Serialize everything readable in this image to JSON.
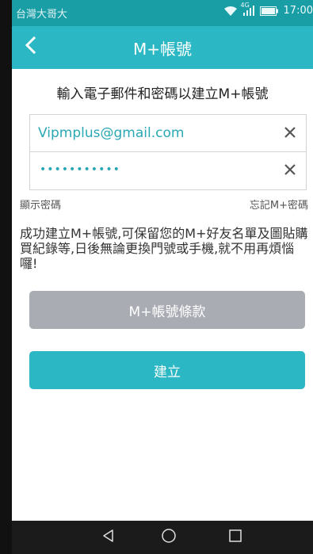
{
  "status_bar": {
    "carrier": "台灣大哥大",
    "network": "4G",
    "time": "17:00"
  },
  "app_bar": {
    "title": "M+帳號"
  },
  "form": {
    "heading": "輸入電子郵件和密碼以建立M+帳號",
    "email_value": "Vipmplus@gmail.com",
    "password_value": "•••••••••••",
    "show_password_label": "顯示密碼",
    "forgot_password_label": "忘記M+密碼",
    "description": "成功建立M+帳號,可保留您的M+好友名單及圖貼購買紀錄等,日後無論更換門號或手機,就不用再煩惱囉!"
  },
  "buttons": {
    "terms_label": "M+帳號條款",
    "create_label": "建立"
  },
  "colors": {
    "accent": "#2bb7c3",
    "status_bar": "#1a9ea6",
    "disabled_button": "#a9acb3",
    "nav_bar": "#1b1b1b"
  },
  "icons": {
    "back": "chevron-left-icon",
    "clear": "close-icon",
    "wifi": "wifi-icon",
    "signal": "signal-icon",
    "battery": "battery-icon",
    "nav_back": "triangle-back-icon",
    "nav_home": "circle-home-icon",
    "nav_recents": "square-recents-icon"
  }
}
